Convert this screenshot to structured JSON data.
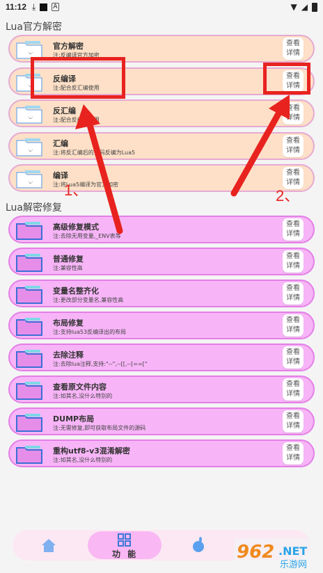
{
  "status": {
    "time": "11:12"
  },
  "sections": [
    {
      "title": "Lua官方解密",
      "items": [
        {
          "title": "官方解密",
          "subtitle": "注:反编译官方加密",
          "button": "查看\n详情"
        },
        {
          "title": "反编译",
          "subtitle": "注:配合反汇编使用",
          "button": "查看\n详情"
        },
        {
          "title": "反汇编",
          "subtitle": "注:配合反编译使用",
          "button": "查看\n详情"
        },
        {
          "title": "汇编",
          "subtitle": "注:将反汇编后的代码反编为Lua5",
          "button": "查看\n详情"
        },
        {
          "title": "编译",
          "subtitle": "注:将Lua5编译为官方加密",
          "button": "查看\n详情"
        }
      ]
    },
    {
      "title": "Lua解密修复",
      "items": [
        {
          "title": "高级修复模式",
          "subtitle": "注:去除无用变量,_ENV表等",
          "button": "查看\n详情"
        },
        {
          "title": "普通修复",
          "subtitle": "注:兼容性高",
          "button": "查看\n详情"
        },
        {
          "title": "变量名整齐化",
          "subtitle": "注:更改部分变量名,兼容性高",
          "button": "查看\n详情"
        },
        {
          "title": "布局修复",
          "subtitle": "注:支持lua53反编译出的布局",
          "button": "查看\n详情"
        },
        {
          "title": "去除注释",
          "subtitle": "注:去除lua注释,支持:\"--\",--[[,--[==[\"",
          "button": "查看\n详情"
        },
        {
          "title": "查看原文件内容",
          "subtitle": "注:如其名,没什么特别的",
          "button": "查看\n详情"
        },
        {
          "title": "DUMP布局",
          "subtitle": "注:无需修复,即可获取布局文件的源码",
          "button": "查看\n详情"
        },
        {
          "title": "重构utf8-v3混淆解密",
          "subtitle": "注:如其名,没什么特别的",
          "button": "查看\n详情"
        }
      ]
    }
  ],
  "annotations": {
    "label1": "1、",
    "label2": "2、",
    "color": "#e8231f"
  },
  "bottom_nav": {
    "active_label": "功 能"
  },
  "watermark": {
    "number": "962",
    "domain": ".NET",
    "caption": "乐游网"
  },
  "colors": {
    "orange_card": "#fde0c7",
    "pink_card": "#f7b5f7",
    "nav_active": "#f9b7f3"
  }
}
